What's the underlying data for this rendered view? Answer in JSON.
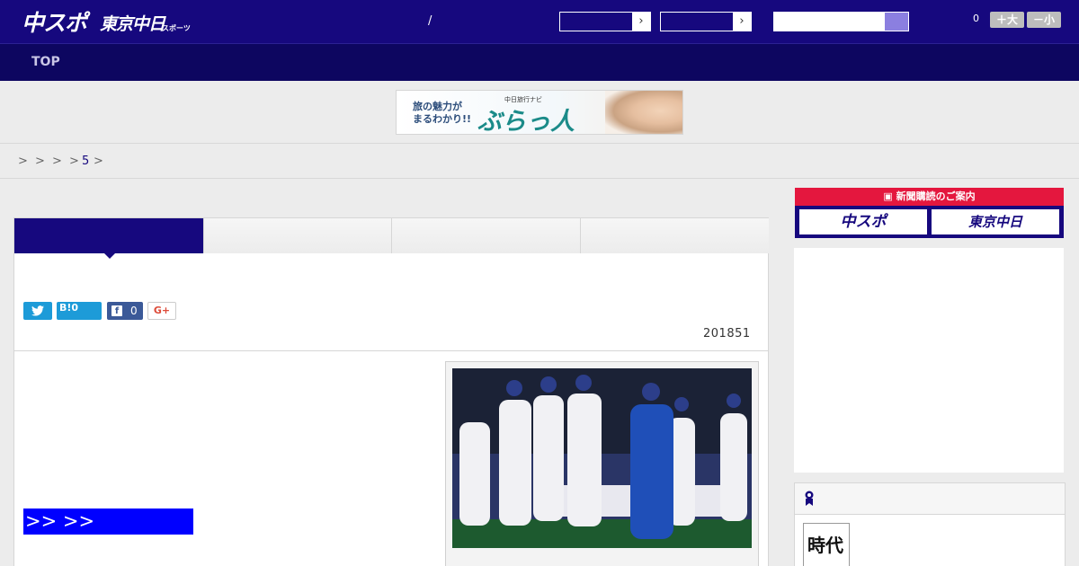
{
  "header": {
    "logo_chuspo": "中スポ",
    "logo_tokyo": "東京中日",
    "logo_tokyo_sub": "スポーツ",
    "separator": "/",
    "selector_1_arrow": "›",
    "selector_2_arrow": "›",
    "counter": "0",
    "font_larger": "＋大",
    "font_smaller": "－小"
  },
  "nav": {
    "top_label": "TOP"
  },
  "banner": {
    "line1": "旅の魅力が",
    "line2": "まるわかり!!",
    "sub": "中日旅行ナビ",
    "main": "ぶらっ人"
  },
  "breadcrumb": {
    "sep1": ">",
    "sep2": ">",
    "sep3": ">",
    "sep4": ">",
    "current": "5",
    "sep5": ">"
  },
  "article": {
    "share_twitter_icon": "twitter-bird",
    "share_hatena": "B!",
    "share_hatena_count": "0",
    "share_facebook_count": "0",
    "share_gplus": "G+",
    "date": "201851",
    "link_text": ">> >>"
  },
  "sidebar": {
    "promo_title": "新聞購読のご案内",
    "promo_chuspo": "中スポ",
    "promo_tokyo": "東京中日"
  },
  "ranking": {
    "thumb_text": "時代"
  },
  "colors": {
    "brand_navy": "#16087e",
    "nav_dark": "#0d0660",
    "promo_red": "#e4173e",
    "link_blue": "#0000ff",
    "twitter": "#1d9bd8",
    "facebook": "#3b5998"
  }
}
